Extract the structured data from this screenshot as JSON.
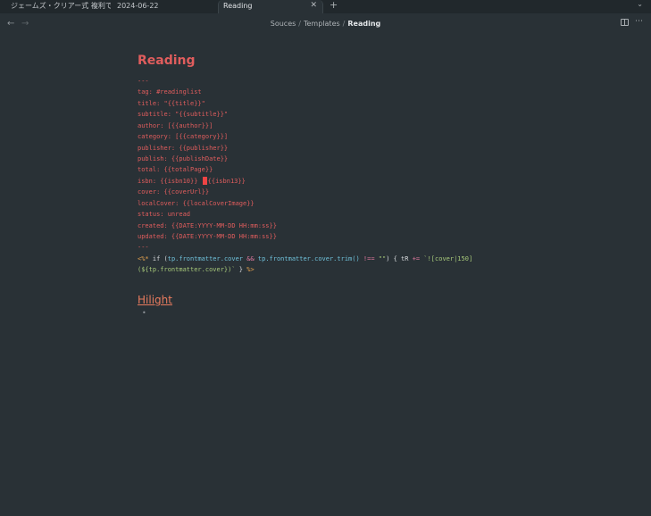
{
  "tabs": [
    {
      "label": "ジェームズ・クリアー式 複利で..."
    },
    {
      "label": "2024-06-22"
    },
    {
      "label": "Reading",
      "close": "✕"
    }
  ],
  "new_tab": "+",
  "tab_list": "⌄",
  "nav": {
    "back": "←",
    "forward": "→"
  },
  "breadcrumb": {
    "parts": [
      "Souces",
      "Templates",
      "Reading"
    ],
    "sep": "/"
  },
  "more_options": "⋯",
  "doc": {
    "title": "Reading",
    "frontmatter": [
      "---",
      "tag: #readinglist",
      "title: \"{{title}}\"",
      "subtitle: \"{{subtitle}}\"",
      "author: [{{author}}]",
      "category: [{{category}}]",
      "publisher: {{publisher}}",
      "publish: {{publishDate}}",
      "total: {{totalPage}}",
      "isbn: {{isbn10}}",
      "{{isbn13}}",
      "cover: {{coverUrl}}",
      "localCover: {{localCoverImage}}",
      "status: unread",
      "created: {{DATE:YYYY-MM-DD HH:mm:ss}}",
      "updated: {{DATE:YYYY-MM-DD HH:mm:ss}}",
      "---"
    ],
    "template": {
      "open": "<%*",
      "if": " if (",
      "cond_a": "tp.frontmatter.cover",
      "and": " && ",
      "cond_b": "tp.frontmatter.cover.trim()",
      "neq": " !== ",
      "empty": "\"\"",
      "body_a": ") { tR ",
      "plus_eq": "+=",
      "str_a": " `![cover|150]",
      "str_b": "(${tp.frontmatter.cover})`",
      "close_brace": " } ",
      "close": "%>"
    },
    "heading2": "Hilight",
    "bullet": "•"
  }
}
